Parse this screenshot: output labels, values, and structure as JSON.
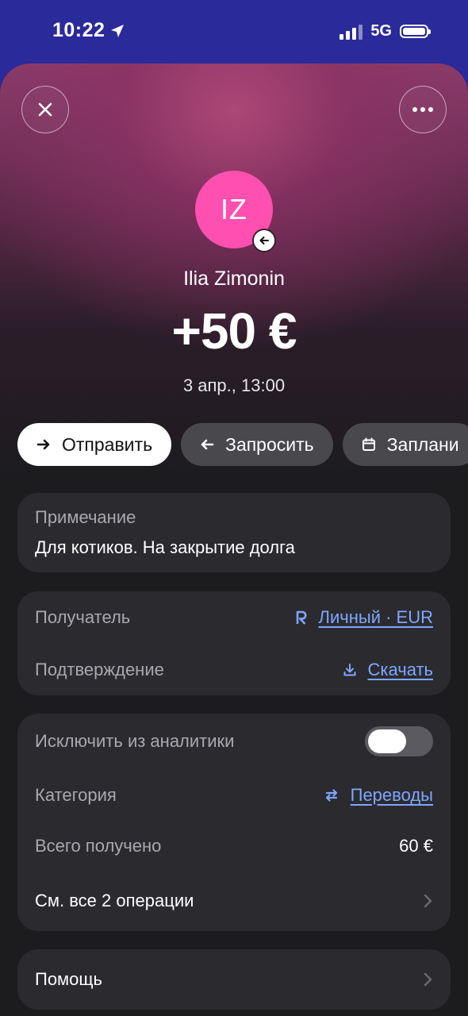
{
  "status": {
    "time": "10:22",
    "network": "5G"
  },
  "header": {
    "avatar_initials": "IZ",
    "name": "Ilia Zimonin",
    "amount": "+50 €",
    "date": "3 апр., 13:00"
  },
  "actions": [
    {
      "label": "Отправить",
      "icon": "arrow-right-icon"
    },
    {
      "label": "Запросить",
      "icon": "arrow-left-icon"
    },
    {
      "label": "Заплани",
      "icon": "calendar-icon"
    }
  ],
  "note": {
    "label": "Примечание",
    "text": "Для котиков. На закрытие долга"
  },
  "details": {
    "recipient_label": "Получатель",
    "recipient_value": "Личный · EUR",
    "confirmation_label": "Подтверждение",
    "confirmation_value": "Скачать"
  },
  "analytics": {
    "exclude_label": "Исключить из аналитики",
    "exclude_on": false,
    "category_label": "Категория",
    "category_value": "Переводы",
    "total_label": "Всего получено",
    "total_value": "60 €",
    "all_ops_label": "См. все 2 операции"
  },
  "help": {
    "label": "Помощь"
  },
  "colors": {
    "avatar": "#ff4fb0",
    "link": "#7fa6ff",
    "card": "#2b2b2f"
  }
}
